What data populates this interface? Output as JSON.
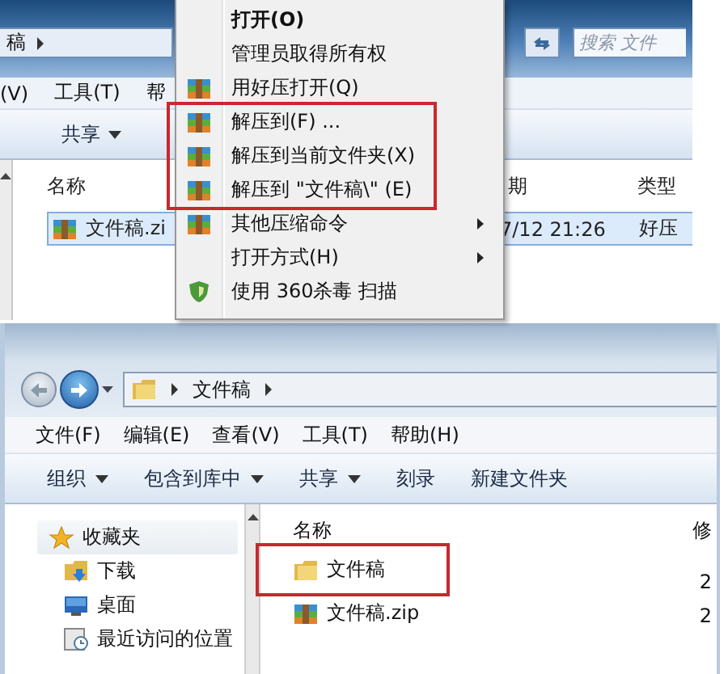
{
  "top_window": {
    "address": {
      "path": "稿"
    },
    "search": {
      "placeholder": "搜索 文件"
    },
    "menu_bar": [
      "(V)",
      "工具(T)",
      "帮"
    ],
    "toolbar": [
      {
        "label": "共享",
        "dropdown": true
      }
    ],
    "columns": [
      "名称",
      "期",
      "类型"
    ],
    "files": [
      {
        "name": "文件稿.zi",
        "date": "7/12 21:26",
        "type": "好压",
        "kind": "archive",
        "selected": true
      }
    ]
  },
  "context_menu": {
    "items": [
      {
        "label": "打开(O)",
        "kind": "plain",
        "default": true,
        "submenu": false,
        "annotated": false
      },
      {
        "label": "管理员取得所有权",
        "kind": "plain",
        "default": false,
        "submenu": false,
        "annotated": false
      },
      {
        "label": "用好压打开(Q)",
        "kind": "archive",
        "default": false,
        "submenu": false,
        "annotated": false
      },
      {
        "label": "解压到(F) ...",
        "kind": "archive",
        "default": false,
        "submenu": false,
        "annotated": true
      },
      {
        "label": "解压到当前文件夹(X)",
        "kind": "archive",
        "default": false,
        "submenu": false,
        "annotated": true
      },
      {
        "label": "解压到 \"文件稿\\\" (E)",
        "kind": "archive",
        "default": false,
        "submenu": false,
        "annotated": true
      },
      {
        "label": "其他压缩命令",
        "kind": "archive",
        "default": false,
        "submenu": true,
        "annotated": false
      },
      {
        "label": "打开方式(H)",
        "kind": "plain",
        "default": false,
        "submenu": true,
        "annotated": false
      },
      {
        "label": "使用 360杀毒 扫描",
        "kind": "shield",
        "default": false,
        "submenu": false,
        "annotated": false
      }
    ]
  },
  "bottom_window": {
    "address": {
      "path": "文件稿"
    },
    "menu_bar": [
      "文件(F)",
      "编辑(E)",
      "查看(V)",
      "工具(T)",
      "帮助(H)"
    ],
    "toolbar": [
      {
        "label": "组织",
        "dropdown": true
      },
      {
        "label": "包含到库中",
        "dropdown": true
      },
      {
        "label": "共享",
        "dropdown": true
      },
      {
        "label": "刻录",
        "dropdown": false
      },
      {
        "label": "新建文件夹",
        "dropdown": false
      }
    ],
    "sidebar": {
      "items": [
        {
          "label": "收藏夹",
          "kind": "star",
          "selected": true,
          "children": [
            {
              "label": "下载",
              "kind": "download",
              "selected": false
            },
            {
              "label": "桌面",
              "kind": "desktop",
              "selected": false
            },
            {
              "label": "最近访问的位置",
              "kind": "recent",
              "selected": false
            }
          ]
        }
      ]
    },
    "columns": [
      "名称",
      "修"
    ],
    "files": [
      {
        "name": "文件稿",
        "date": "2",
        "kind": "folder",
        "selected": false,
        "annotated": true
      },
      {
        "name": "文件稿.zip",
        "date": "2",
        "kind": "archive",
        "selected": false,
        "annotated": false
      }
    ]
  }
}
